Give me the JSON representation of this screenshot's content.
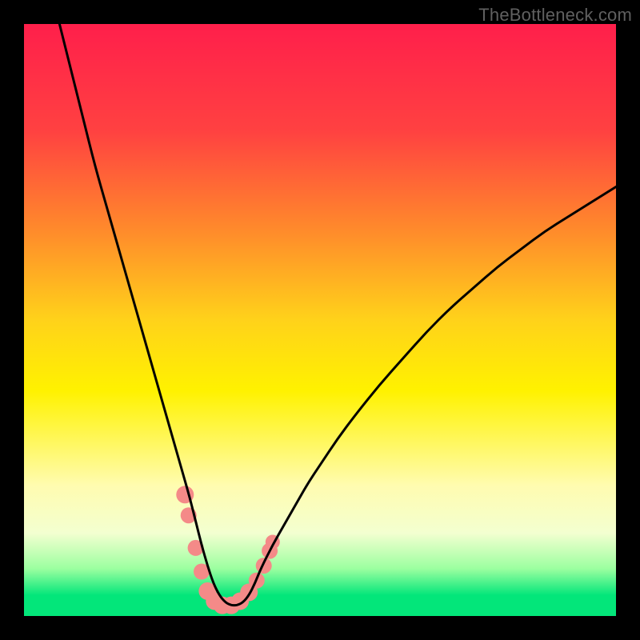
{
  "watermark": "TheBottleneck.com",
  "chart_data": {
    "type": "line",
    "title": "",
    "xlabel": "",
    "ylabel": "",
    "xlim": [
      0,
      100
    ],
    "ylim": [
      0,
      100
    ],
    "gradient_stops": [
      {
        "offset": 0.0,
        "color": "#ff1f4b"
      },
      {
        "offset": 0.18,
        "color": "#ff4141"
      },
      {
        "offset": 0.35,
        "color": "#ff8b2b"
      },
      {
        "offset": 0.5,
        "color": "#ffd21a"
      },
      {
        "offset": 0.62,
        "color": "#fff200"
      },
      {
        "offset": 0.78,
        "color": "#fffcb0"
      },
      {
        "offset": 0.86,
        "color": "#f3ffd0"
      },
      {
        "offset": 0.92,
        "color": "#9cffa0"
      },
      {
        "offset": 0.965,
        "color": "#03e67a"
      },
      {
        "offset": 1.0,
        "color": "#03e67a"
      }
    ],
    "series": [
      {
        "name": "bottleneck-curve",
        "x": [
          6,
          8,
          10,
          12,
          14,
          16,
          18,
          20,
          22,
          24,
          26,
          27,
          28,
          29,
          30,
          31,
          32,
          33,
          34,
          35,
          36,
          37,
          38,
          39,
          40,
          42,
          44,
          46,
          48,
          50,
          53,
          56,
          60,
          64,
          68,
          72,
          76,
          80,
          84,
          88,
          92,
          96,
          100
        ],
        "y": [
          100,
          92,
          84,
          76,
          69,
          62,
          55,
          48,
          41,
          34,
          27,
          23.5,
          20,
          16,
          12,
          8.5,
          5.5,
          3.5,
          2.3,
          1.8,
          1.8,
          2.3,
          3.5,
          5.5,
          8.0,
          12.0,
          15.5,
          19.0,
          22.5,
          25.5,
          30.0,
          34.0,
          39.0,
          43.5,
          48.0,
          52.0,
          55.5,
          59.0,
          62.0,
          65.0,
          67.5,
          70.0,
          72.5
        ]
      }
    ],
    "markers": {
      "name": "highlight-points",
      "color": "#f48a88",
      "points": [
        {
          "x": 27.2,
          "y": 20.5,
          "r": 11
        },
        {
          "x": 27.8,
          "y": 17.0,
          "r": 10
        },
        {
          "x": 29.0,
          "y": 11.5,
          "r": 10
        },
        {
          "x": 30.0,
          "y": 7.5,
          "r": 10
        },
        {
          "x": 31.0,
          "y": 4.2,
          "r": 11
        },
        {
          "x": 32.2,
          "y": 2.5,
          "r": 11
        },
        {
          "x": 33.5,
          "y": 1.8,
          "r": 11
        },
        {
          "x": 35.0,
          "y": 1.8,
          "r": 11
        },
        {
          "x": 36.5,
          "y": 2.5,
          "r": 11
        },
        {
          "x": 38.0,
          "y": 4.0,
          "r": 11
        },
        {
          "x": 39.3,
          "y": 6.0,
          "r": 10
        },
        {
          "x": 40.5,
          "y": 8.5,
          "r": 10
        },
        {
          "x": 41.5,
          "y": 11.0,
          "r": 10
        },
        {
          "x": 42.0,
          "y": 12.5,
          "r": 9
        }
      ]
    }
  }
}
